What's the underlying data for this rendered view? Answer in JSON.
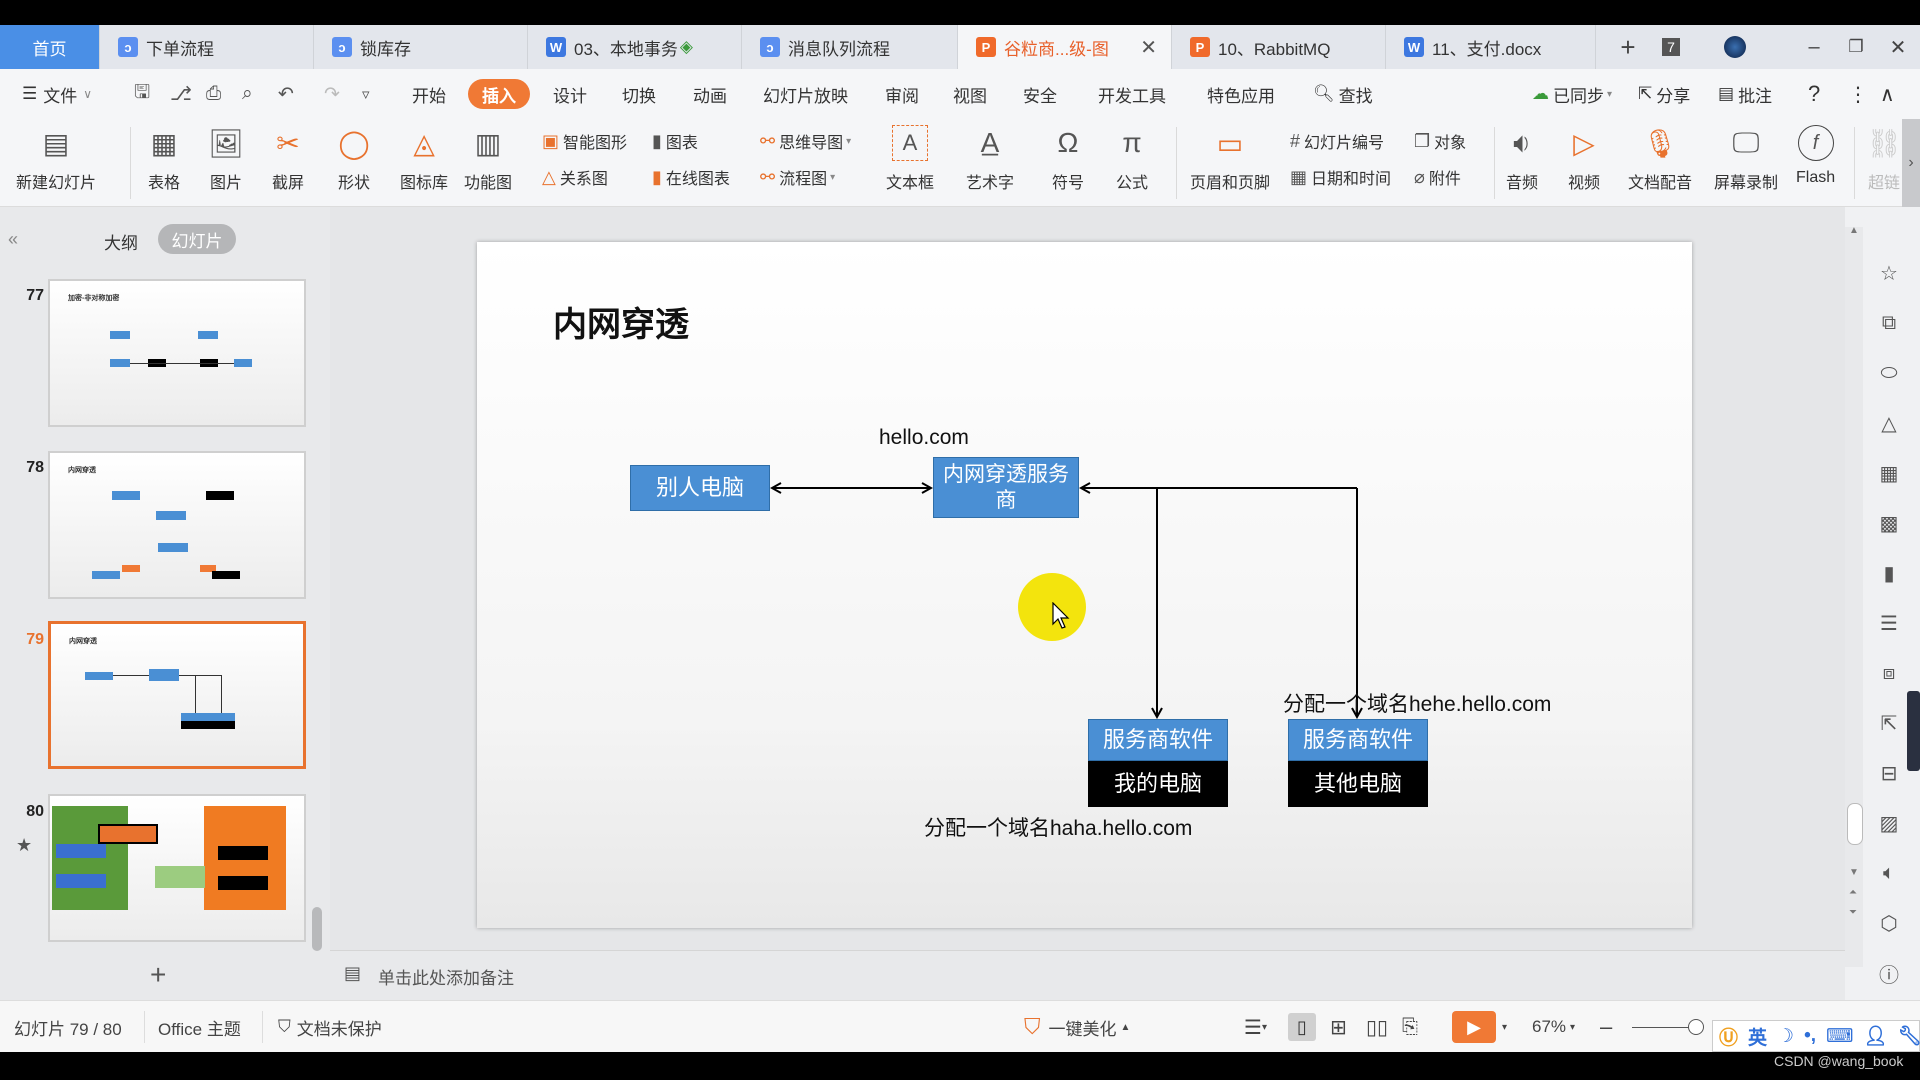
{
  "tabs": [
    {
      "label": "首页",
      "icon": "home"
    },
    {
      "label": "下单流程",
      "icon": "flowchart-icon"
    },
    {
      "label": "锁库存",
      "icon": "flowchart-icon"
    },
    {
      "label": "03、本地事务",
      "icon": "word-icon"
    },
    {
      "label": "消息队列流程",
      "icon": "flowchart-icon"
    },
    {
      "label": "谷粒商...级-图",
      "icon": "ppt-icon",
      "active": true
    },
    {
      "label": "10、RabbitMQ",
      "icon": "ppt-icon"
    },
    {
      "label": "11、支付.docx",
      "icon": "word-icon"
    }
  ],
  "tab_badge": "7",
  "menu": {
    "file": "文件",
    "items": [
      "开始",
      "插入",
      "设计",
      "切换",
      "动画",
      "幻灯片放映",
      "审阅",
      "视图",
      "安全",
      "开发工具",
      "特色应用"
    ],
    "active": "插入",
    "search": "查找",
    "sync": "已同步",
    "share": "分享",
    "comment": "批注"
  },
  "ribbon": {
    "new_slide": "新建幻灯片",
    "table": "表格",
    "picture": "图片",
    "screenshot": "截屏",
    "shape": "形状",
    "icon_lib": "图标库",
    "func_chart": "功能图",
    "smart_art": "智能图形",
    "chart": "图表",
    "relation": "关系图",
    "online_chart": "在线图表",
    "mindmap": "思维导图",
    "flowchart": "流程图",
    "textbox": "文本框",
    "wordart": "艺术字",
    "symbol": "符号",
    "formula": "公式",
    "header_footer": "页眉和页脚",
    "slide_number": "幻灯片编号",
    "object": "对象",
    "datetime": "日期和时间",
    "attachment": "附件",
    "audio": "音频",
    "video": "视频",
    "doc_voice": "文档配音",
    "screen_record": "屏幕录制",
    "flash": "Flash",
    "hyperlink": "超链"
  },
  "left_panel": {
    "outline_tab": "大纲",
    "slides_tab": "幻灯片",
    "slides": [
      {
        "num": "77",
        "title": "加密-非对称加密"
      },
      {
        "num": "78",
        "title": "内网穿透"
      },
      {
        "num": "79",
        "title": "内网穿透",
        "active": true
      },
      {
        "num": "80",
        "title": ""
      }
    ]
  },
  "slide": {
    "title": "内网穿透",
    "nodes": {
      "other_pc": "别人电脑",
      "provider": "内网穿透服务商",
      "provider_domain": "hello.com",
      "sw1": "服务商软件",
      "my_pc": "我的电脑",
      "sw2": "服务商软件",
      "other_pc2": "其他电脑"
    },
    "label_haha": "分配一个域名haha.hello.com",
    "label_hehe": "分配一个域名hehe.hello.com",
    "colors": {
      "blue_box": "#4a8fd4",
      "black_box": "#000000",
      "cursor_highlight": "#f2e300"
    }
  },
  "notes_placeholder": "单击此处添加备注",
  "status": {
    "slide_pos": "幻灯片 79 / 80",
    "theme": "Office 主题",
    "protection": "文档未保护",
    "beautify": "一键美化",
    "zoom": "67%"
  },
  "ime": {
    "lang": "英"
  },
  "watermark": "CSDN @wang_book",
  "accent_color": "#f07935"
}
